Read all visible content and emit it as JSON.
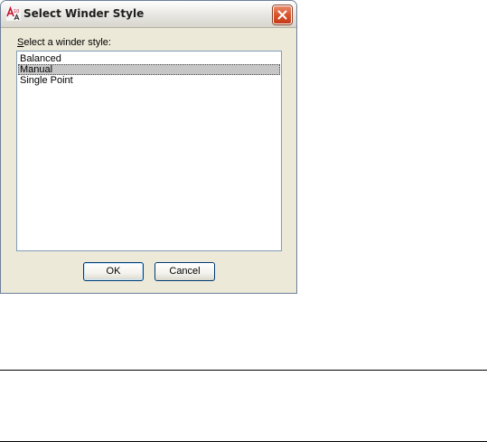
{
  "window": {
    "title": "Select Winder Style",
    "icon": "autocad-architecture-icon",
    "close_icon": "close-icon"
  },
  "prompt": {
    "mnemonic": "S",
    "rest": "elect a winder style:"
  },
  "list": {
    "items": [
      "Balanced",
      "Manual",
      "Single Point"
    ],
    "selected": "Manual"
  },
  "buttons": {
    "ok": "OK",
    "cancel": "Cancel"
  }
}
